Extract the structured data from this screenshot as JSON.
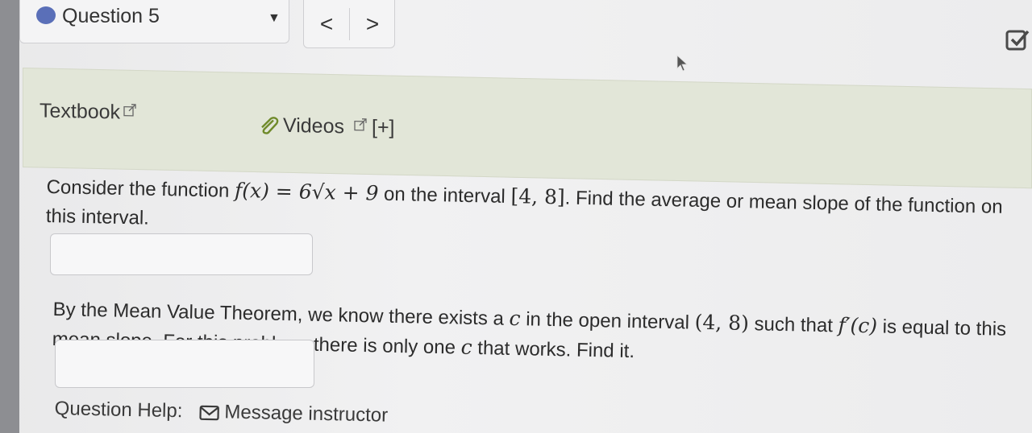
{
  "header": {
    "question_label": "Question 5",
    "prev_label": "<",
    "next_label": ">"
  },
  "resources": {
    "textbook_label": "Textbook",
    "videos_label": "Videos",
    "expand_label": "[+]"
  },
  "question": {
    "p1_a": "Consider the function ",
    "p1_func": "f(x) = 6√x + 9",
    "p1_b": " on the interval ",
    "p1_interval": "[4, 8]",
    "p1_c": ". Find the average or mean slope of the function on this interval.",
    "p2_a": "By the Mean Value Theorem, we know there exists a ",
    "p2_c1": "c",
    "p2_b": " in the open interval ",
    "p2_interval": "(4, 8)",
    "p2_d": " such that ",
    "p2_deriv": "f′(c)",
    "p2_e": " is equal to this mean slope. For this problem, there is only one ",
    "p2_c2": "c",
    "p2_f": " that works. Find it."
  },
  "help": {
    "label": "Question Help:",
    "message_label": "Message instructor"
  },
  "colors": {
    "accent_dot": "#5a6fb8",
    "resource_bg": "#e2e6d8"
  }
}
